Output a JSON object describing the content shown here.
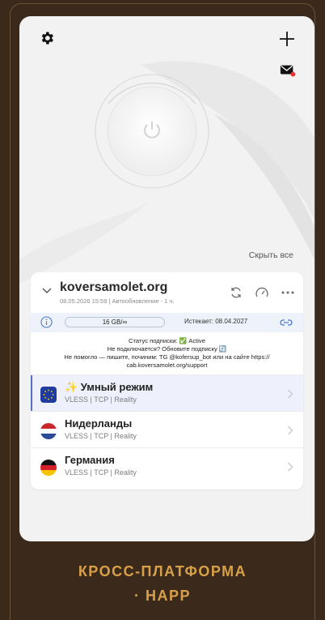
{
  "top_bar": {
    "settings_icon": "gear-icon",
    "add_icon": "plus-icon",
    "mail_icon": "mail-alert-icon"
  },
  "power": {
    "icon": "power-icon",
    "state": "off"
  },
  "hide_all_label": "Скрыть все",
  "subscription": {
    "name": "koversamolet.org",
    "meta": "08.05.2026 15:59 | Автообновление - 1 ч.",
    "traffic": "16 GB/∞",
    "expires": "Истекает: 08.04.2027",
    "notice_line1": "Статус подписки: ✅ Active",
    "notice_line2": "Не подключается? Обновите подписку 🔄",
    "notice_line3": "Не помогло — пишите, починим: TG @kofersup_bot или на сайте https://",
    "notice_line4": "cab.koversamolet.org/support"
  },
  "servers": [
    {
      "name": "✨ Умный режим",
      "proto": "VLESS | TCP | Reality",
      "flag": "eu",
      "active": true
    },
    {
      "name": "Нидерланды",
      "proto": "VLESS | TCP | Reality",
      "flag": "nl",
      "active": false
    },
    {
      "name": "Германия",
      "proto": "VLESS | TCP | Reality",
      "flag": "de",
      "active": false
    }
  ],
  "footer": {
    "line1": "КРОСС-ПЛАТФОРМА",
    "line2": "· HAPP"
  },
  "colors": {
    "accent": "#d9a04a",
    "active_bar": "#5a6fc8",
    "background": "#3b2a1c"
  }
}
